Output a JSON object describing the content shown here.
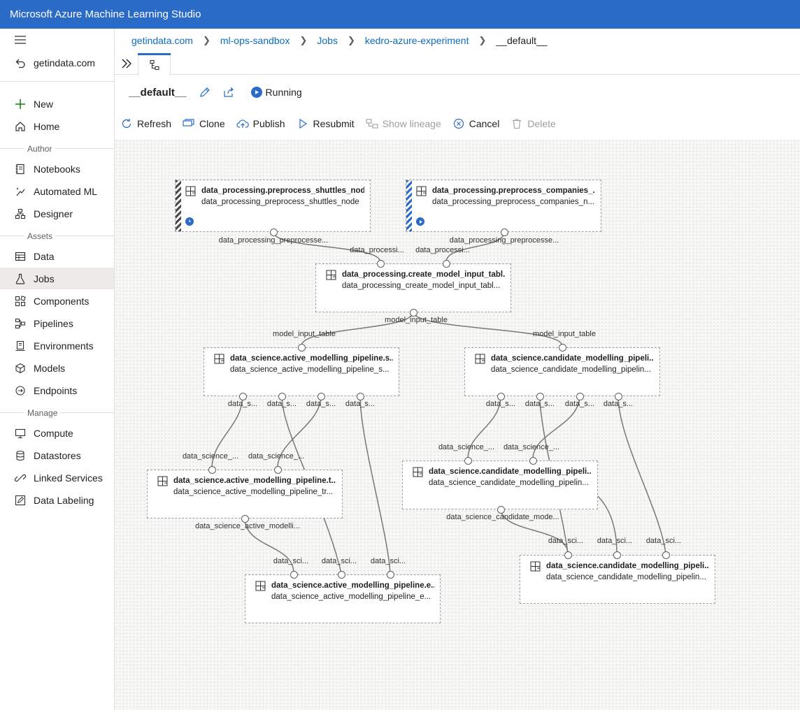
{
  "app": {
    "title": "Microsoft Azure Machine Learning Studio"
  },
  "sidebar": {
    "back_label": "getindata.com",
    "new_label": "New",
    "home_label": "Home",
    "sections": {
      "author": "Author",
      "assets": "Assets",
      "manage": "Manage"
    },
    "author_items": [
      {
        "label": "Notebooks",
        "icon": "notebook-icon"
      },
      {
        "label": "Automated ML",
        "icon": "automl-icon"
      },
      {
        "label": "Designer",
        "icon": "designer-icon"
      }
    ],
    "asset_items": [
      {
        "label": "Data",
        "icon": "data-icon"
      },
      {
        "label": "Jobs",
        "icon": "flask-icon"
      },
      {
        "label": "Components",
        "icon": "components-icon"
      },
      {
        "label": "Pipelines",
        "icon": "pipelines-icon"
      },
      {
        "label": "Environments",
        "icon": "environments-icon"
      },
      {
        "label": "Models",
        "icon": "models-icon"
      },
      {
        "label": "Endpoints",
        "icon": "endpoints-icon"
      }
    ],
    "manage_items": [
      {
        "label": "Compute",
        "icon": "compute-icon"
      },
      {
        "label": "Datastores",
        "icon": "datastore-icon"
      },
      {
        "label": "Linked Services",
        "icon": "link-icon"
      },
      {
        "label": "Data Labeling",
        "icon": "labeling-icon"
      }
    ],
    "active_item": "Jobs"
  },
  "breadcrumb": [
    "getindata.com",
    "ml-ops-sandbox",
    "Jobs",
    "kedro-azure-experiment",
    "__default__"
  ],
  "job": {
    "title": "__default__",
    "status": "Running"
  },
  "toolbar": {
    "refresh": "Refresh",
    "clone": "Clone",
    "publish": "Publish",
    "resubmit": "Resubmit",
    "show_lineage": "Show lineage",
    "cancel": "Cancel",
    "delete": "Delete"
  },
  "graph": {
    "nodes": {
      "preprocess_shuttles": {
        "title": "data_processing.preprocess_shuttles_node",
        "subtitle": "data_processing_preprocess_shuttles_node",
        "status": "queued"
      },
      "preprocess_companies": {
        "title": "data_processing.preprocess_companies_...",
        "subtitle": "data_processing_preprocess_companies_n...",
        "status": "running"
      },
      "create_model_input": {
        "title": "data_processing.create_model_input_tabl...",
        "subtitle": "data_processing_create_model_input_tabl..."
      },
      "active_split": {
        "title": "data_science.active_modelling_pipeline.s...",
        "subtitle": "data_science_active_modelling_pipeline_s..."
      },
      "candidate_split": {
        "title": "data_science.candidate_modelling_pipeli...",
        "subtitle": "data_science_candidate_modelling_pipelin..."
      },
      "active_train": {
        "title": "data_science.active_modelling_pipeline.t...",
        "subtitle": "data_science_active_modelling_pipeline_tr..."
      },
      "candidate_train": {
        "title": "data_science.candidate_modelling_pipeli...",
        "subtitle": "data_science_candidate_modelling_pipelin..."
      },
      "active_eval": {
        "title": "data_science.active_modelling_pipeline.e...",
        "subtitle": "data_science_active_modelling_pipeline_e..."
      },
      "candidate_eval": {
        "title": "data_science.candidate_modelling_pipeli...",
        "subtitle": "data_science_candidate_modelling_pipelin..."
      }
    },
    "port_labels": {
      "shuttles_out": "data_processing_preprocesse...",
      "companies_out": "data_processing_preprocesse...",
      "cmi_in_1": "data_processi...",
      "cmi_in_2": "data_processi...",
      "cmi_out": "model_input_table",
      "active_in": "model_input_table",
      "candidate_in": "model_input_table",
      "split_out": "data_s...",
      "train_in": "data_science_...",
      "active_train_out": "data_science_active_modelli...",
      "candidate_train_out": "data_science_candidate_mode...",
      "eval_in": "data_sci..."
    }
  }
}
